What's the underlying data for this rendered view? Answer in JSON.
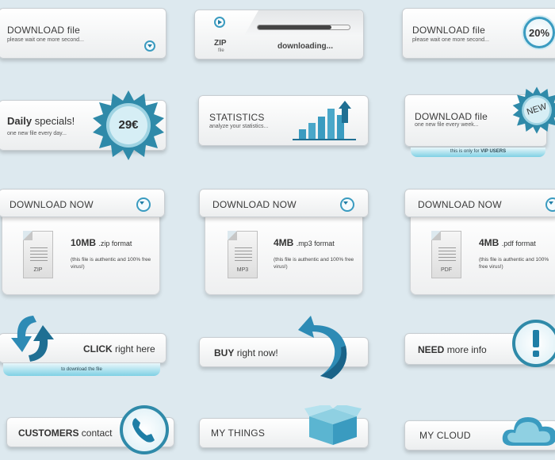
{
  "row1": {
    "card1": {
      "title": "DOWNLOAD file",
      "subtitle": "please wait one more second..."
    },
    "card2": {
      "zip_label": "ZIP",
      "file_label": "file",
      "status": "downloading..."
    },
    "card3": {
      "title": "DOWNLOAD file",
      "subtitle": "please wait one more second...",
      "percent": "20%"
    }
  },
  "row2": {
    "daily": {
      "title_bold": "Daily",
      "title_rest": "specials!",
      "subtitle": "one new file every day...",
      "price": "29€"
    },
    "stats": {
      "title": "STATISTICS",
      "subtitle": "analyze your statistics..."
    },
    "new_file": {
      "title": "DOWNLOAD file",
      "subtitle": "one new file every week...",
      "badge": "NEW",
      "ribbon_text": "this is only for",
      "ribbon_bold": "VIP USERS"
    }
  },
  "row3": [
    {
      "button": "DOWNLOAD NOW",
      "size": "10MB",
      "format": ".zip format",
      "note": "(this file is authentic and 100% free virus!)",
      "ext": "ZIP"
    },
    {
      "button": "DOWNLOAD NOW",
      "size": "4MB",
      "format": ".mp3 format",
      "note": "(this file is authentic and 100% free virus!)",
      "ext": "MP3"
    },
    {
      "button": "DOWNLOAD NOW",
      "size": "4MB",
      "format": ".pdf format",
      "note": "(this file is authentic and 100% free virus!)",
      "ext": "PDF"
    }
  ],
  "row4": {
    "click": {
      "bold": "CLICK",
      "rest": "right here",
      "ribbon": "to download the file"
    },
    "buy": {
      "bold": "BUY",
      "rest": "right now!"
    },
    "need": {
      "bold": "NEED",
      "rest": "more info"
    }
  },
  "row5": {
    "customers": {
      "bold": "CUSTOMERS",
      "rest": "contact"
    },
    "things": {
      "label": "MY THINGS"
    },
    "cloud": {
      "label": "MY CLOUD"
    }
  },
  "colors": {
    "accent": "#3a9bc0",
    "accent_dark": "#1f6f93",
    "background": "#dde9ef"
  },
  "icons": [
    "chevron-down-icon",
    "play-icon",
    "bar-chart-icon",
    "file-icon",
    "refresh-arrow-icon",
    "exclamation-icon",
    "phone-icon",
    "box-icon",
    "cloud-icon"
  ]
}
